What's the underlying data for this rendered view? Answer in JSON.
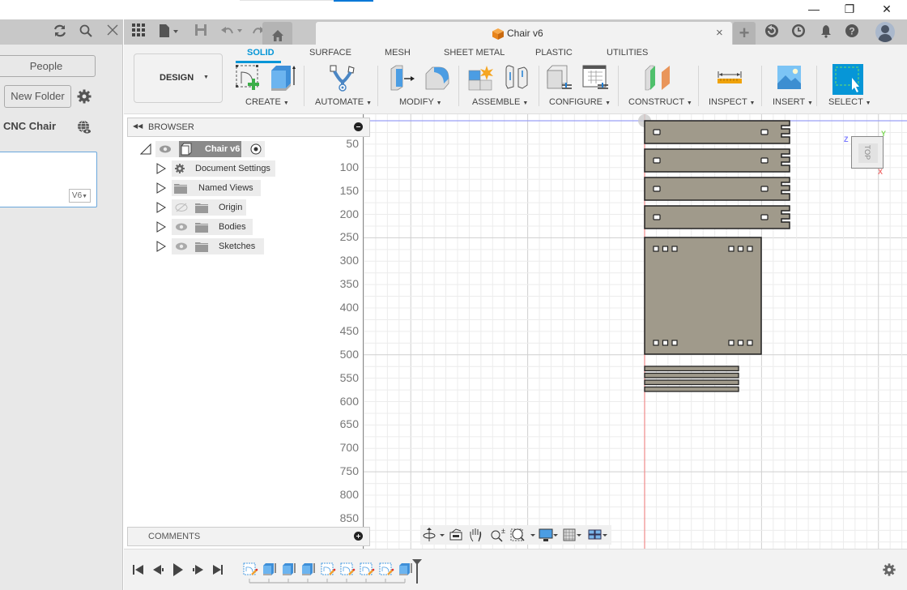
{
  "window": {
    "minimize_icon": "minimize-icon",
    "restore_icon": "restore-icon",
    "close_icon": "close-icon",
    "controls": [
      "—",
      "❐",
      "✕"
    ]
  },
  "data_panel": {
    "people_label": "People",
    "new_folder_label": "New Folder",
    "project_name": "CNC Chair",
    "version_badge": "V6",
    "icons": {
      "refresh": "⟳",
      "search": "⚲",
      "close": "✕",
      "settings": "⚙",
      "globe": "⊕"
    }
  },
  "app_bar": {
    "document_tab_title": "Chair v6",
    "tab_close": "×",
    "new_tab": "+",
    "icons": [
      "grid-apps-icon",
      "file-icon",
      "save-icon",
      "undo-icon",
      "redo-icon",
      "home-icon",
      "job-status-icon",
      "history-icon",
      "notifications-icon",
      "help-icon",
      "user-avatar"
    ]
  },
  "toolbar": {
    "workspace_label": "DESIGN",
    "tabs": [
      {
        "label": "SOLID",
        "active": true
      },
      {
        "label": "SURFACE",
        "active": false
      },
      {
        "label": "MESH",
        "active": false
      },
      {
        "label": "SHEET METAL",
        "active": false
      },
      {
        "label": "PLASTIC",
        "active": false
      },
      {
        "label": "UTILITIES",
        "active": false
      }
    ],
    "groups": [
      {
        "label": "CREATE"
      },
      {
        "label": "AUTOMATE"
      },
      {
        "label": "MODIFY"
      },
      {
        "label": "ASSEMBLE"
      },
      {
        "label": "CONFIGURE"
      },
      {
        "label": "CONSTRUCT"
      },
      {
        "label": "INSPECT"
      },
      {
        "label": "INSERT"
      },
      {
        "label": "SELECT"
      }
    ],
    "accent_color": "#0696d7"
  },
  "browser": {
    "title": "BROWSER",
    "root": {
      "label": "Chair v6"
    },
    "items": [
      {
        "label": "Document Settings",
        "icon": "gear-icon",
        "visible": null
      },
      {
        "label": "Named Views",
        "icon": "folder-icon",
        "visible": null
      },
      {
        "label": "Origin",
        "icon": "folder-icon",
        "visible": false
      },
      {
        "label": "Bodies",
        "icon": "folder-icon",
        "visible": true
      },
      {
        "label": "Sketches",
        "icon": "folder-icon",
        "visible": true
      }
    ]
  },
  "ruler": {
    "ticks": [
      "50",
      "100",
      "150",
      "200",
      "250",
      "300",
      "350",
      "400",
      "450",
      "500",
      "550",
      "600",
      "650",
      "700",
      "750",
      "800",
      "850"
    ]
  },
  "viewcube": {
    "face": "TOP",
    "axes": {
      "x": "X",
      "y": "Y",
      "z": "Z"
    }
  },
  "comments": {
    "title": "COMMENTS"
  },
  "navbar": {
    "tools": [
      "orbit",
      "look-at",
      "pan",
      "zoom",
      "fit",
      "display-settings",
      "grid-settings",
      "viewports"
    ]
  },
  "timeline": {
    "controls": [
      "first",
      "previous",
      "play",
      "next",
      "last"
    ],
    "features": [
      "sketch",
      "extrude",
      "extrude",
      "extrude",
      "sketch",
      "sketch",
      "sketch",
      "sketch",
      "extrude"
    ]
  },
  "colors": {
    "part_fill": "#a09a8b",
    "part_stroke": "#222222",
    "grid_minor": "#ececec",
    "grid_major": "#cfcfcf",
    "axis_red": "#f08a8a",
    "axis_blue": "#9aa0f5"
  }
}
